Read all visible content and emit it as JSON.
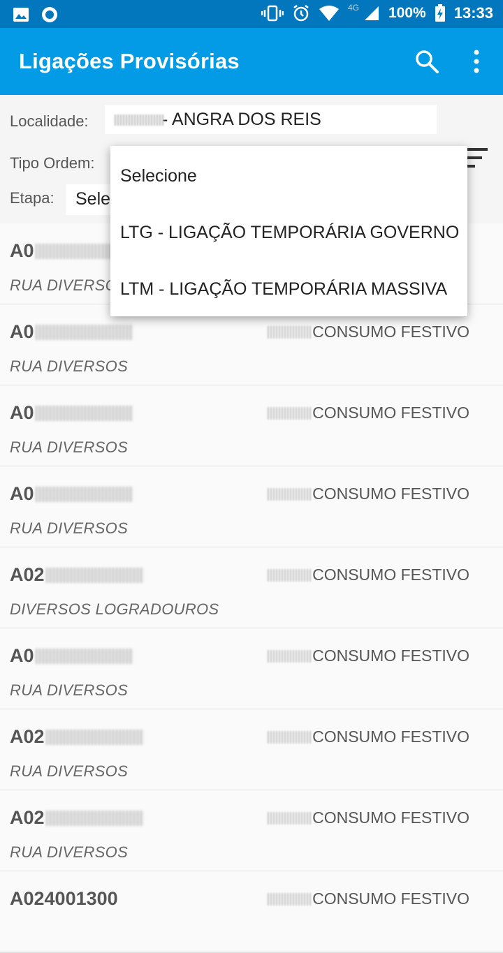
{
  "status_bar": {
    "network": "4G",
    "battery": "100%",
    "time": "13:33"
  },
  "app_bar": {
    "title": "Ligações Provisórias"
  },
  "filters": {
    "localidade_label": "Localidade:",
    "localidade_value": "- ANGRA DOS REIS",
    "tipo_ordem_label": "Tipo Ordem:",
    "etapa_label": "Etapa:",
    "etapa_value": "Sele"
  },
  "dropdown": {
    "options": [
      "Selecione",
      "LTG - LIGAÇÃO TEMPORÁRIA GOVERNO",
      "LTM - LIGAÇÃO TEMPORÁRIA MASSIVA"
    ]
  },
  "list": {
    "items": [
      {
        "code": "A0",
        "type": "",
        "address": "RUA DIVERSOS"
      },
      {
        "code": "A0",
        "type": "CONSUMO FESTIVO",
        "address": "RUA DIVERSOS"
      },
      {
        "code": "A0",
        "type": "CONSUMO FESTIVO",
        "address": "RUA DIVERSOS"
      },
      {
        "code": "A0",
        "type": "CONSUMO FESTIVO",
        "address": "RUA DIVERSOS"
      },
      {
        "code": "A02",
        "type": "CONSUMO FESTIVO",
        "address": "DIVERSOS LOGRADOUROS"
      },
      {
        "code": "A0",
        "type": "CONSUMO FESTIVO",
        "address": "RUA DIVERSOS"
      },
      {
        "code": "A02",
        "type": "CONSUMO FESTIVO",
        "address": "RUA DIVERSOS"
      },
      {
        "code": "A02",
        "type": "CONSUMO FESTIVO",
        "address": "RUA DIVERSOS"
      },
      {
        "code": "A024001300",
        "type": "CONSUMO FESTIVO",
        "address": ""
      }
    ]
  },
  "colors": {
    "status_bar": "#0277bd",
    "app_bar": "#039be5"
  }
}
